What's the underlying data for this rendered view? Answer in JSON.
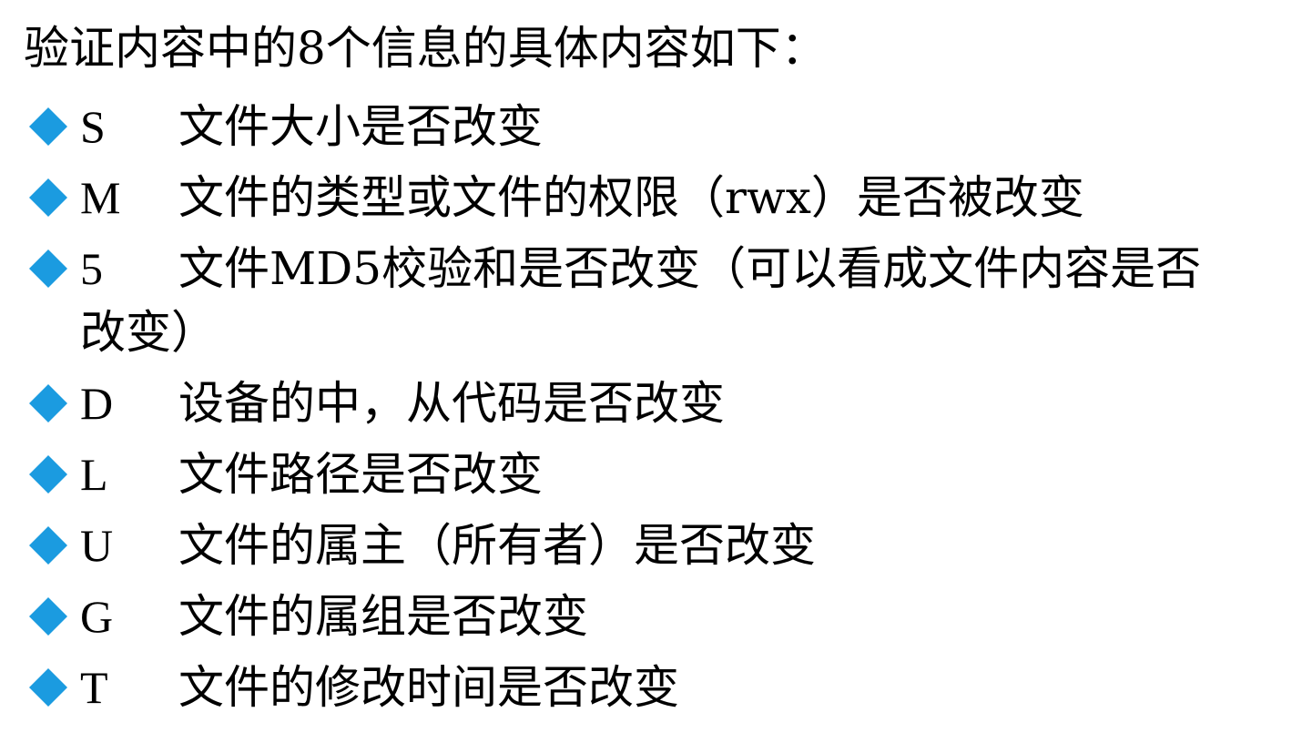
{
  "title": "验证内容中的8个信息的具体内容如下：",
  "bullet_color": "#1b9be0",
  "items": [
    {
      "code": "S",
      "desc": "文件大小是否改变"
    },
    {
      "code": "M",
      "desc": "文件的类型或文件的权限（rwx）是否被改变"
    },
    {
      "code": "5",
      "desc": "文件MD5校验和是否改变（可以看成文件内容是否",
      "desc2": "改变）"
    },
    {
      "code": "D",
      "desc": "设备的中，从代码是否改变"
    },
    {
      "code": "L",
      "desc": "文件路径是否改变"
    },
    {
      "code": "U",
      "desc": "文件的属主（所有者）是否改变"
    },
    {
      "code": "G",
      "desc": "文件的属组是否改变"
    },
    {
      "code": "T",
      "desc": "文件的修改时间是否改变"
    }
  ]
}
